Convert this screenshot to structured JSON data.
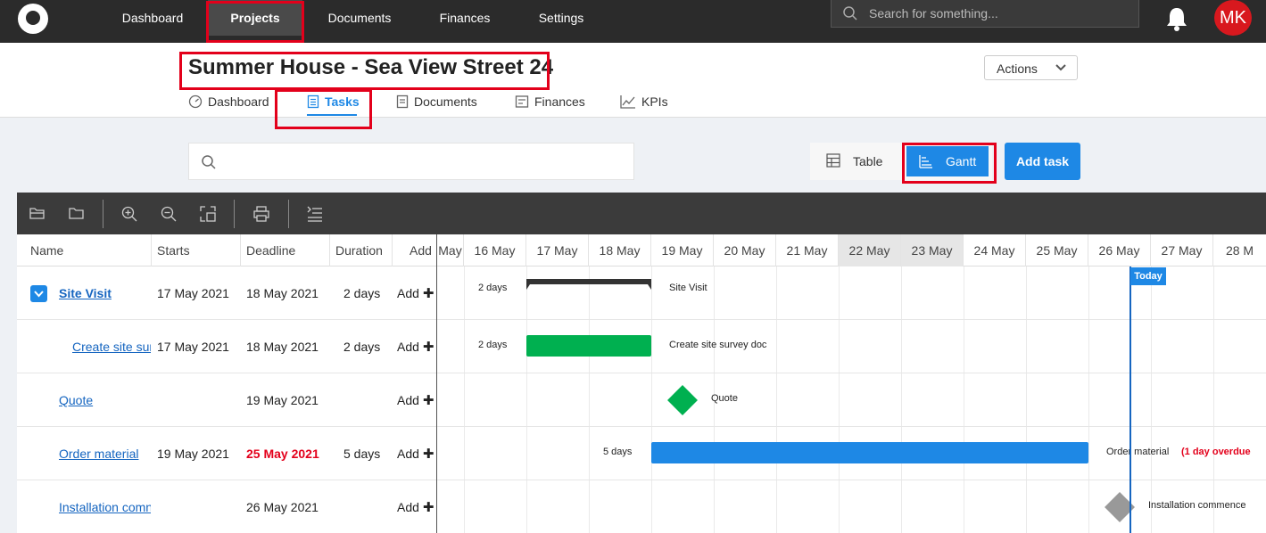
{
  "topnav": {
    "items": [
      "Dashboard",
      "Projects",
      "Documents",
      "Finances",
      "Settings"
    ],
    "search_placeholder": "Search for something...",
    "avatar_initials": "MK"
  },
  "project": {
    "title": "Summer House - Sea View Street 24",
    "actions_label": "Actions",
    "subtabs": [
      "Dashboard",
      "Tasks",
      "Documents",
      "Finances",
      "KPIs"
    ]
  },
  "toolbar": {
    "view_table": "Table",
    "view_gantt": "Gantt",
    "add_task": "Add task"
  },
  "gantt": {
    "columns": [
      "Name",
      "Starts",
      "Deadline",
      "Duration",
      "Add"
    ],
    "days": [
      "May",
      "16 May",
      "17 May",
      "18 May",
      "19 May",
      "20 May",
      "21 May",
      "22 May",
      "23 May",
      "24 May",
      "25 May",
      "26 May",
      "27 May",
      "28 M"
    ],
    "today_label": "Today",
    "add_label": "Add",
    "rows": [
      {
        "name": "Site Visit",
        "starts": "17 May 2021",
        "deadline": "18 May 2021",
        "duration": "2 days",
        "bar_left_label": "2 days",
        "bar_label": "Site Visit",
        "overdue": ""
      },
      {
        "name": "Create site sur",
        "starts": "17 May 2021",
        "deadline": "18 May 2021",
        "duration": "2 days",
        "bar_left_label": "2 days",
        "bar_label": "Create site survey doc",
        "overdue": ""
      },
      {
        "name": "Quote",
        "starts": "",
        "deadline": "19 May 2021",
        "duration": "",
        "bar_left_label": "",
        "bar_label": "Quote",
        "overdue": ""
      },
      {
        "name": "Order material",
        "starts": "19 May 2021",
        "deadline": "25 May 2021",
        "duration": "5 days",
        "bar_left_label": "5 days",
        "bar_label": "Order material",
        "overdue": "(1 day overdue"
      },
      {
        "name": "Installation comn",
        "starts": "",
        "deadline": "26 May 2021",
        "duration": "",
        "bar_left_label": "",
        "bar_label": "Installation commence",
        "overdue": ""
      }
    ]
  },
  "colors": {
    "accent": "#1e88e5",
    "green": "#00b050",
    "red": "#e3001b",
    "nav": "#2b2b2b",
    "milestone_gray": "#999999"
  }
}
